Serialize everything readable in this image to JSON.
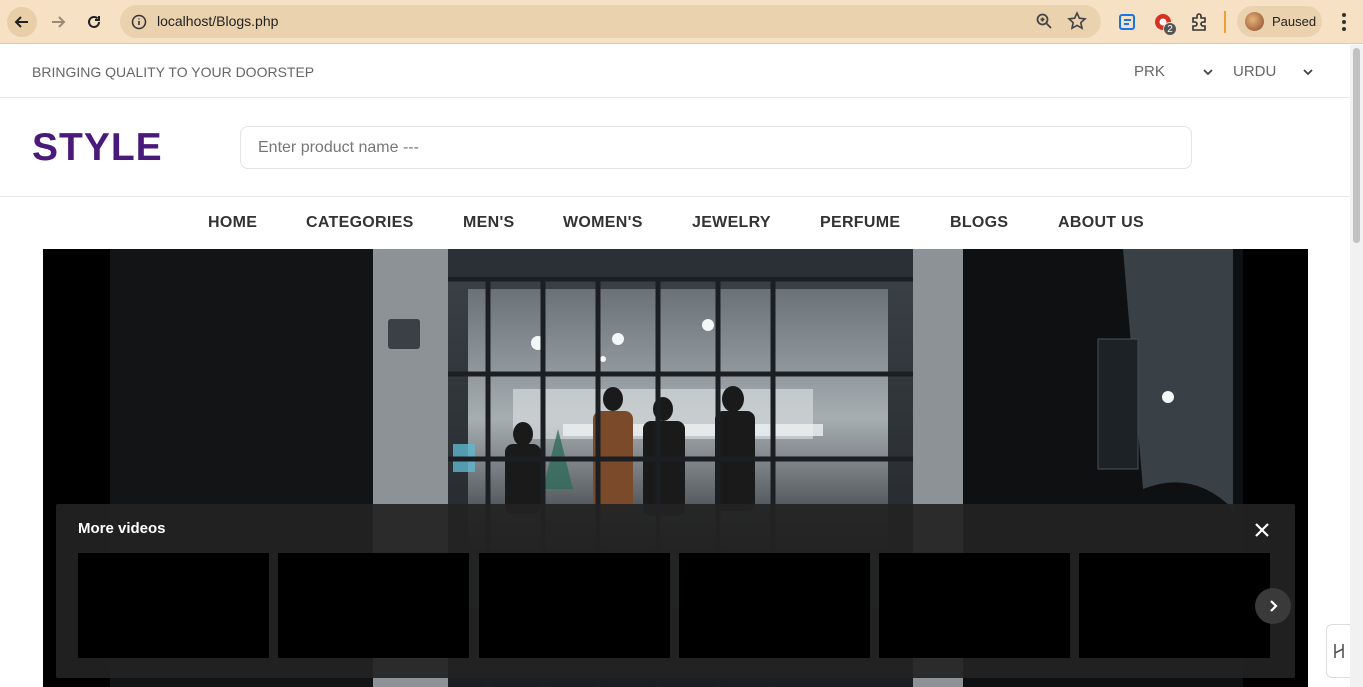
{
  "browser": {
    "url": "localhost/Blogs.php",
    "profile_label": "Paused",
    "extension_badge": "2"
  },
  "topbar": {
    "tagline": "BRINGING QUALITY TO YOUR DOORSTEP",
    "currency": "PRK",
    "language": "URDU"
  },
  "header": {
    "logo": "STYLE",
    "search_placeholder": "Enter product name ---"
  },
  "nav": {
    "items": [
      "HOME",
      "CATEGORIES",
      "MEN'S",
      "WOMEN'S",
      "JEWELRY",
      "PERFUME",
      "BLOGS",
      "ABOUT US"
    ]
  },
  "video": {
    "more_videos_title": "More videos"
  },
  "colors": {
    "logo": "#4a1a7a",
    "chrome_bg": "#f6e1c4"
  }
}
